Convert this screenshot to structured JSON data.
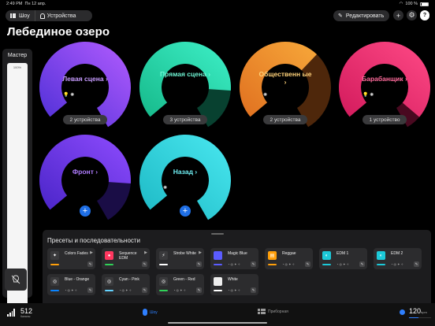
{
  "status": {
    "time": "2:49 PM",
    "date": "Пн 12 апр.",
    "battery": "100 %"
  },
  "header": {
    "show_label": "Шоу",
    "devices_label": "Устройства",
    "edit_label": "Редактировать",
    "add_icon": "+",
    "help_icon": "?"
  },
  "page_title": "Лебединое озеро",
  "master": {
    "label": "Мастер",
    "percent_label": "100%",
    "level": 1.0
  },
  "groups": [
    {
      "label": "Левая сцена",
      "chevron": "›",
      "devices": "2 устройства",
      "level": 1.0,
      "colors": [
        "#4d2fd6",
        "#b35cff"
      ],
      "label_color": "#c79bff",
      "icons": "💡 ✺"
    },
    {
      "label": "Прямая сцена",
      "chevron": "›",
      "devices": "3 устройства",
      "level": 0.8,
      "colors": [
        "#16b98a",
        "#3ef0c8"
      ],
      "label_color": "#6ff5d4",
      "icons": ""
    },
    {
      "label": "Общественн ые",
      "chevron": "›",
      "devices": "2 устройства",
      "level": 0.62,
      "colors": [
        "#e07020",
        "#f7a83a"
      ],
      "label_color": "#ffd27a",
      "icons": "✺"
    },
    {
      "label": "Барабанщик",
      "chevron": "›",
      "devices": "1 устройство",
      "level": 0.93,
      "colors": [
        "#d21a5c",
        "#ff4a86"
      ],
      "label_color": "#ff6b9c",
      "icons": "💡 ✺"
    },
    {
      "label": "Фронт",
      "chevron": "›",
      "devices": "",
      "level": 0.8,
      "colors": [
        "#4a25c8",
        "#8f4cff"
      ],
      "label_color": "#b07dff",
      "icons": "",
      "add": "+"
    },
    {
      "label": "Назад",
      "chevron": "›",
      "devices": "",
      "level": 1.0,
      "colors": [
        "#1cb8c4",
        "#4ae8f0"
      ],
      "label_color": "#6ff0f5",
      "icons": "✺",
      "add": "+"
    }
  ],
  "presets": {
    "title": "Пресеты и последовательности",
    "items": [
      {
        "name": "Colors Fades",
        "icon": "wand-icon",
        "icon_color": "#3a3a3c",
        "glyph": "✦",
        "play": "▶",
        "bar": "#ff9f0a"
      },
      {
        "name": "Sequence EDM",
        "icon": "record-icon",
        "icon_color": "#ff375f",
        "glyph": "●",
        "play": "▶",
        "bar": "#30d158"
      },
      {
        "name": "Strobe White",
        "icon": "bolt-icon",
        "icon_color": "#3a3a3c",
        "glyph": "⚡",
        "play": "▶",
        "bar": "#ffffff"
      },
      {
        "name": "Magic Blue",
        "icon": "swatch-icon",
        "icon_color": "#5b5cff",
        "glyph": "",
        "play": "",
        "bar": "#5b5cff",
        "dots": "◔ ◎ ✦ ✧"
      },
      {
        "name": "Reggae",
        "icon": "bars-icon",
        "icon_color": "#ff9f0a",
        "glyph": "▤",
        "play": "",
        "bar": "#ff9f0a",
        "dots": "◔ ◎ ✦ ✧"
      },
      {
        "name": "EDM 1",
        "icon": "half-circle-icon",
        "icon_color": "#1cc9d8",
        "glyph": "◐",
        "play": "",
        "bar": "#1cc9d8",
        "dots": "◔ ◎ ✦ ✧"
      },
      {
        "name": "EDM 2",
        "icon": "half-circle-icon",
        "icon_color": "#1cc9d8",
        "glyph": "◐",
        "play": "",
        "bar": "#1cc9d8",
        "dots": "◔ ◎ ✦ ✧"
      },
      {
        "name": "Blue - Orange",
        "icon": "target-icon",
        "icon_color": "#3a3a3c",
        "glyph": "◎",
        "play": "",
        "bar": "#0a84ff",
        "dots": "◔ ◎ ✦ ✧"
      },
      {
        "name": "Cyan - Pink",
        "icon": "target-icon",
        "icon_color": "#3a3a3c",
        "glyph": "◎",
        "play": "",
        "bar": "#64d2ff",
        "dots": "◔ ◎ ✦ ✧"
      },
      {
        "name": "Green - Red",
        "icon": "target-icon",
        "icon_color": "#3a3a3c",
        "glyph": "◎",
        "play": "",
        "bar": "#30d158",
        "dots": "◔ ◎ ✦ ✧"
      },
      {
        "name": "White",
        "icon": "white-swatch-icon",
        "icon_color": "#eeeeee",
        "glyph": "",
        "play": "",
        "bar": "#ffffff",
        "dots": "◔ ◎ ✦ ✧"
      }
    ]
  },
  "bottom": {
    "signal_value": "512",
    "signal_sub": "Каналы",
    "show_tab": "Шоу",
    "panel_tab": "Приборная",
    "bpm_value": "120",
    "bpm_unit": "bpm",
    "bpm_level": 0.42
  }
}
